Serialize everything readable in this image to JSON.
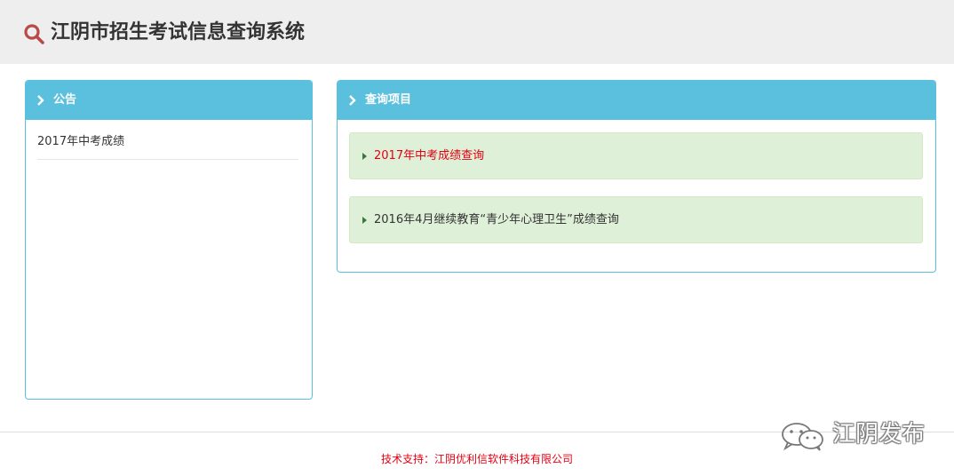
{
  "header": {
    "title": "江阴市招生考试信息查询系统",
    "icon": "search-icon",
    "icon_color": "#b94a48"
  },
  "notice_panel": {
    "heading": "公告",
    "items": [
      {
        "label": "2017年中考成绩"
      }
    ]
  },
  "query_panel": {
    "heading": "查询项目",
    "items": [
      {
        "label": "2017年中考成绩查询",
        "color": "#e60012"
      },
      {
        "label": "2016年4月继续教育“青少年心理卫生”成绩查询",
        "color": "#333333"
      }
    ]
  },
  "footer": {
    "text": "技术支持：江阴优利信软件科技有限公司"
  },
  "watermark": {
    "text": "江阴发布",
    "icon": "wechat-icon"
  },
  "colors": {
    "accent": "#5bc0de",
    "item_background": "#dff0d8",
    "highlight_text": "#e60012",
    "header_background": "#eeeeee"
  }
}
